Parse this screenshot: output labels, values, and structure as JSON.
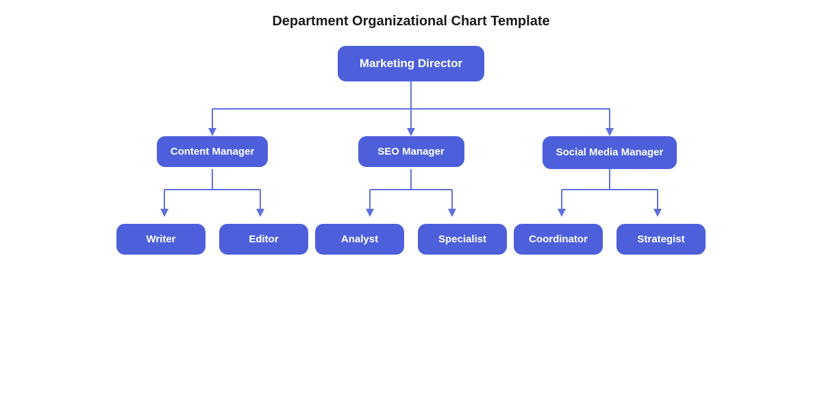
{
  "title": "Department Organizational Chart Template",
  "nodes": {
    "root": "Marketing Director",
    "mid": [
      "Content Manager",
      "SEO Manager",
      "Social Media Manager"
    ],
    "leaves": [
      [
        "Writer",
        "Editor"
      ],
      [
        "Analyst",
        "Specialist"
      ],
      [
        "Coordinator",
        "Strategist"
      ]
    ]
  },
  "colors": {
    "node_bg": "#4d5fdb",
    "node_text": "#ffffff",
    "connector": "#6070e0"
  }
}
